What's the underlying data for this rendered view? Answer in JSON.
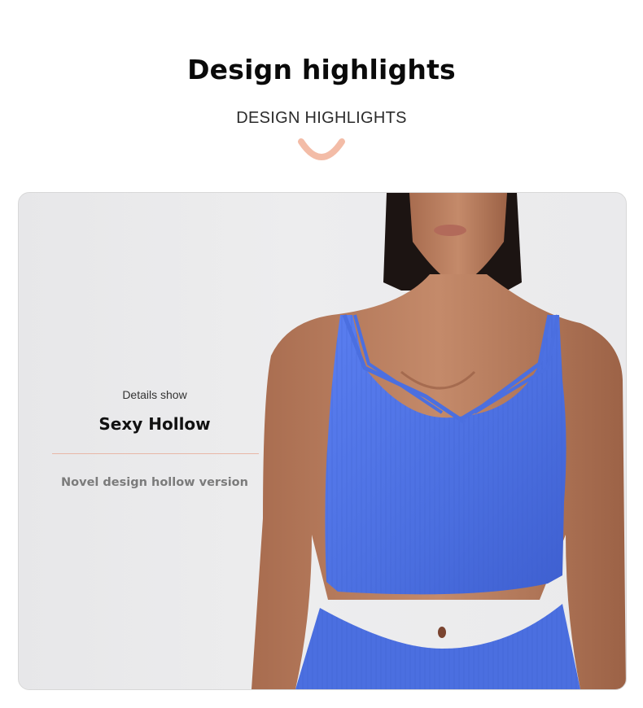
{
  "header": {
    "title": "Design highlights",
    "subtitle": "DESIGN HIGHLIGHTS",
    "accent_color": "#f3bca7"
  },
  "feature": {
    "label": "Details show",
    "heading": "Sexy Hollow",
    "description": "Novel design hollow version",
    "divider_color": "#e8b7a7"
  },
  "product": {
    "garment_color": "#4b6fe0",
    "image_subject": "model-wearing-strappy-crop-top"
  }
}
